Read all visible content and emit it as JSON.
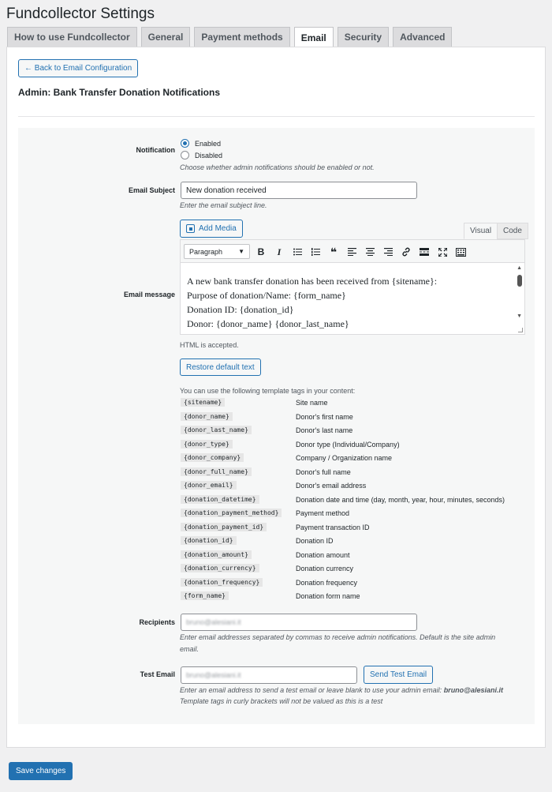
{
  "page": {
    "title": "Fundcollector Settings"
  },
  "tabs": [
    {
      "label": "How to use Fundcollector",
      "active": false
    },
    {
      "label": "General",
      "active": false
    },
    {
      "label": "Payment methods",
      "active": false
    },
    {
      "label": "Email",
      "active": true
    },
    {
      "label": "Security",
      "active": false
    },
    {
      "label": "Advanced",
      "active": false
    }
  ],
  "back_button": "← Back to Email Configuration",
  "section_title": "Admin: Bank Transfer Donation Notifications",
  "notification": {
    "label": "Notification",
    "options": [
      {
        "label": "Enabled",
        "checked": true
      },
      {
        "label": "Disabled",
        "checked": false
      }
    ],
    "description": "Choose whether admin notifications should be enabled or not."
  },
  "email_subject": {
    "label": "Email Subject",
    "value": "New donation received",
    "description": "Enter the email subject line."
  },
  "email_message": {
    "label": "Email message",
    "add_media": "Add Media",
    "tab_visual": "Visual",
    "tab_code": "Code",
    "format": "Paragraph",
    "toolbar_icons": [
      "bold-icon",
      "italic-icon",
      "bullet-list-icon",
      "numbered-list-icon",
      "blockquote-icon",
      "align-left-icon",
      "align-center-icon",
      "align-right-icon",
      "link-icon",
      "read-more-icon",
      "fullscreen-icon",
      "toolbar-toggle-icon"
    ],
    "lines": [
      "A new bank transfer donation has been received from {sitename}:",
      "Purpose of donation/Name: {form_name}",
      "Donation ID: {donation_id}",
      "Donor: {donor_name} {donor_last_name}"
    ],
    "html_note": "HTML is accepted.",
    "restore_button": "Restore default text",
    "tags_intro": "You can use the following template tags in your content:"
  },
  "template_tags": [
    {
      "tag": "{sitename}",
      "desc": "Site name"
    },
    {
      "tag": "{donor_name}",
      "desc": "Donor's first name"
    },
    {
      "tag": "{donor_last_name}",
      "desc": "Donor's last name"
    },
    {
      "tag": "{donor_type}",
      "desc": "Donor type (Individual/Company)"
    },
    {
      "tag": "{donor_company}",
      "desc": "Company / Organization name"
    },
    {
      "tag": "{donor_full_name}",
      "desc": "Donor's full name"
    },
    {
      "tag": "{donor_email}",
      "desc": "Donor's email address"
    },
    {
      "tag": "{donation_datetime}",
      "desc": "Donation date and time (day, month, year, hour, minutes, seconds)"
    },
    {
      "tag": "{donation_payment_method}",
      "desc": "Payment method"
    },
    {
      "tag": "{donation_payment_id}",
      "desc": "Payment transaction ID"
    },
    {
      "tag": "{donation_id}",
      "desc": "Donation ID"
    },
    {
      "tag": "{donation_amount}",
      "desc": "Donation amount"
    },
    {
      "tag": "{donation_currency}",
      "desc": "Donation currency"
    },
    {
      "tag": "{donation_frequency}",
      "desc": "Donation frequency"
    },
    {
      "tag": "{form_name}",
      "desc": "Donation form name"
    }
  ],
  "recipients": {
    "label": "Recipients",
    "value": "bruno@alesiani.it",
    "description_1": "Enter email addresses separated by commas to receive admin notifications. Default is the site admin",
    "description_2": "email."
  },
  "test_email": {
    "label": "Test Email",
    "value": "bruno@alesiani.it",
    "send_button": "Send Test Email",
    "description_1": "Enter an email address to send a test email or leave blank to use your admin email: ",
    "admin_email": "bruno@alesiani.it",
    "description_2": "Template tags in curly brackets will not be valued as this is a test"
  },
  "save_button": "Save changes",
  "colors": {
    "accent": "#2271b1",
    "background": "#f0f0f1",
    "panel": "#ffffff",
    "form_box": "#f6f7f7"
  }
}
